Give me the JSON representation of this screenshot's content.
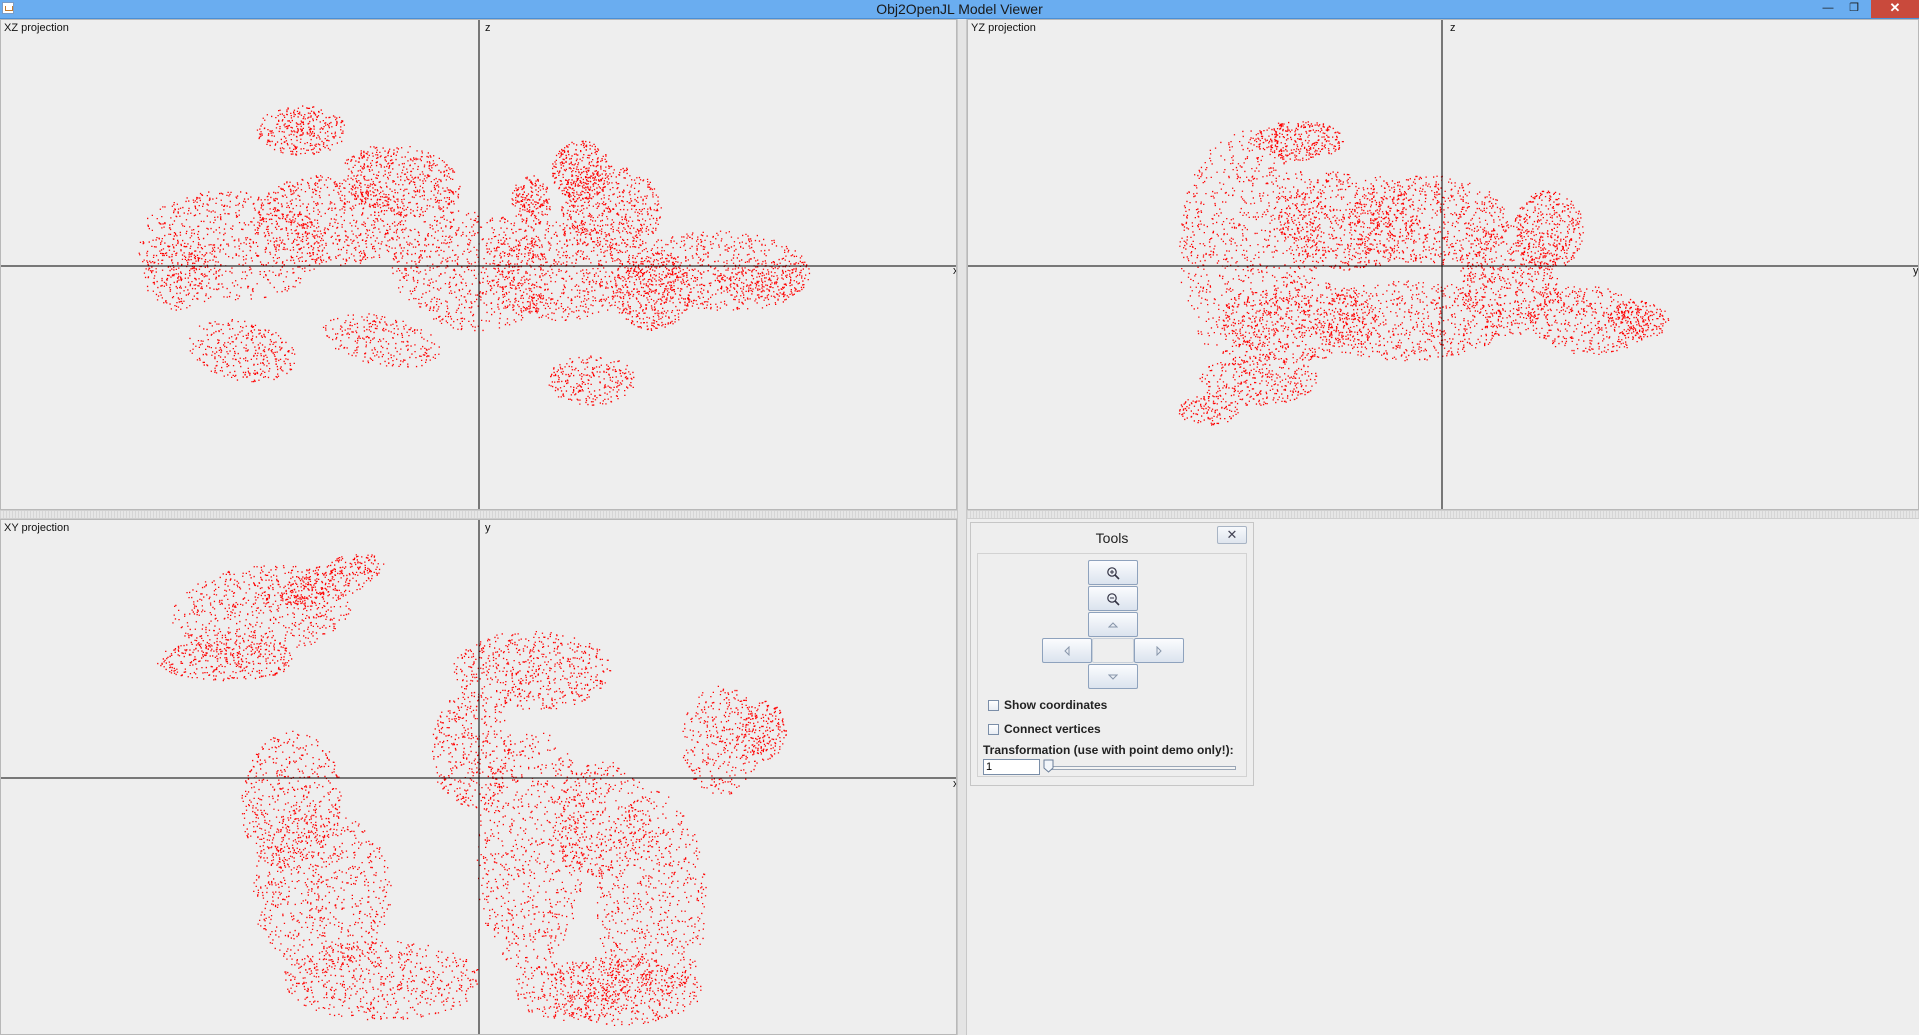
{
  "window": {
    "title": "Obj2OpenJL Model Viewer",
    "controls": {
      "minimize": "—",
      "maximize": "❐",
      "close": "✕"
    }
  },
  "colors": {
    "points": "#ff0000",
    "axes": "#000000",
    "background": "#eeeeee"
  },
  "projections": {
    "xz": {
      "label": "XZ projection",
      "horizontal_axis": "x",
      "vertical_axis": "z"
    },
    "yz": {
      "label": "YZ projection",
      "horizontal_axis": "y",
      "vertical_axis": "z"
    },
    "xy": {
      "label": "XY projection",
      "horizontal_axis": "x",
      "vertical_axis": "y"
    }
  },
  "tools": {
    "title": "Tools",
    "close_label": "✕",
    "buttons": [
      "zoom-in-icon",
      "zoom-out-icon",
      "arrow-up-icon",
      "arrow-left-icon",
      "arrow-right-icon",
      "arrow-down-icon"
    ],
    "show_coordinates": {
      "label": "Show coordinates",
      "checked": false
    },
    "connect_vertices": {
      "label": "Connect vertices",
      "checked": false
    },
    "transformation_label": "Transformation (use with point demo only!):",
    "transformation_value": "1",
    "transformation_slider_level": 0
  }
}
